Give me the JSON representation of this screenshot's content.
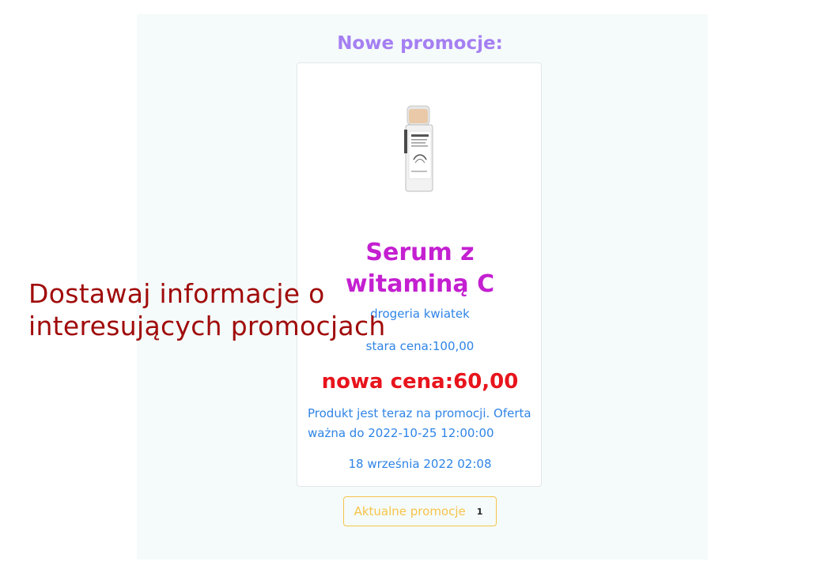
{
  "panel": {
    "heading": "Nowe promocje:"
  },
  "card": {
    "image_alt": "serum bottle",
    "title": "Serum z witaminą C",
    "shop": "drogeria kwiatek",
    "old_price": "stara cena:100,00",
    "new_price": "nowa cena:60,00",
    "description": "Produkt jest teraz na promocji. Oferta ważna do 2022-10-25 12:00:00",
    "date": "18 września 2022 02:08"
  },
  "button": {
    "label": "Aktualne promocje",
    "badge": "1"
  },
  "overlay": {
    "line1": "Dostawaj informacje o",
    "line2": "interesujących promocjach"
  },
  "colors": {
    "heading": "#a57ff2",
    "title": "#c41fd1",
    "link_text": "#2f84e6",
    "new_price": "#e8141c",
    "button_accent": "#f6c34a",
    "overlay_text": "#a00b0b",
    "panel_bg": "#f5fbfa"
  }
}
